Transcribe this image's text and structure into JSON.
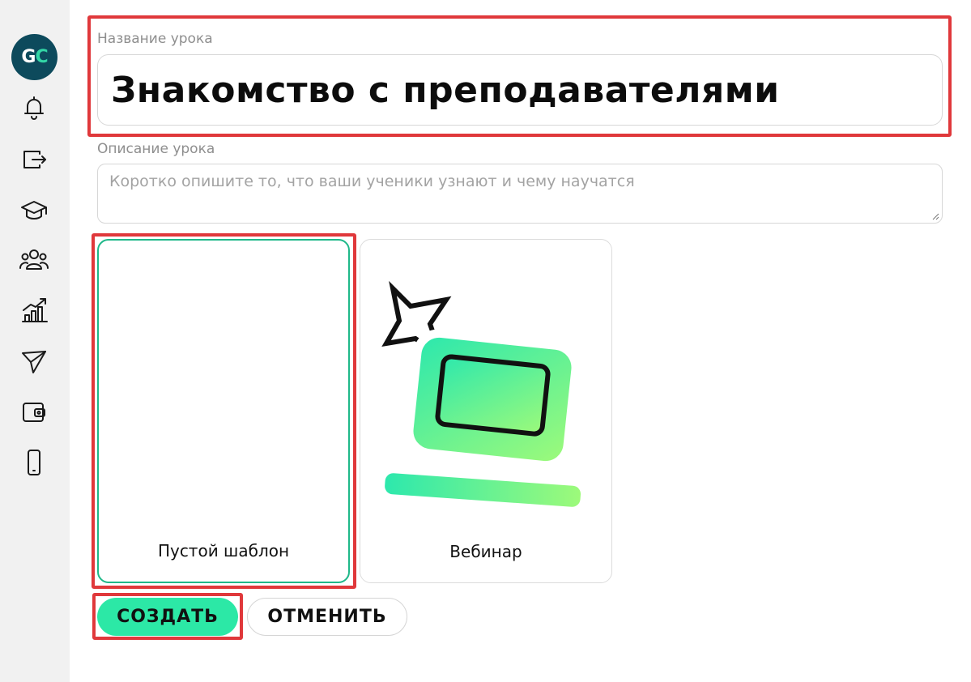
{
  "sidebar": {
    "logo": {
      "left": "G",
      "right": "C"
    },
    "icons": [
      "bell-icon",
      "exit-icon",
      "graduation-cap-icon",
      "users-icon",
      "chart-icon",
      "send-icon",
      "wallet-icon",
      "phone-icon"
    ]
  },
  "form": {
    "title_label": "Название урока",
    "title_value": "Знакомство с преподавателями",
    "description_label": "Описание урока",
    "description_placeholder": "Коротко опишите то, что ваши ученики узнают и чему научатся"
  },
  "templates": [
    {
      "label": "Пустой шаблон",
      "selected": true
    },
    {
      "label": "Вебинар",
      "selected": false
    }
  ],
  "actions": {
    "create": "СОЗДАТЬ",
    "cancel": "ОТМЕНИТЬ"
  },
  "colors": {
    "accent": "#2ce8a6",
    "selected_border": "#1fb889",
    "highlight": "#e0383b",
    "logo_bg": "#0d4a5c"
  }
}
